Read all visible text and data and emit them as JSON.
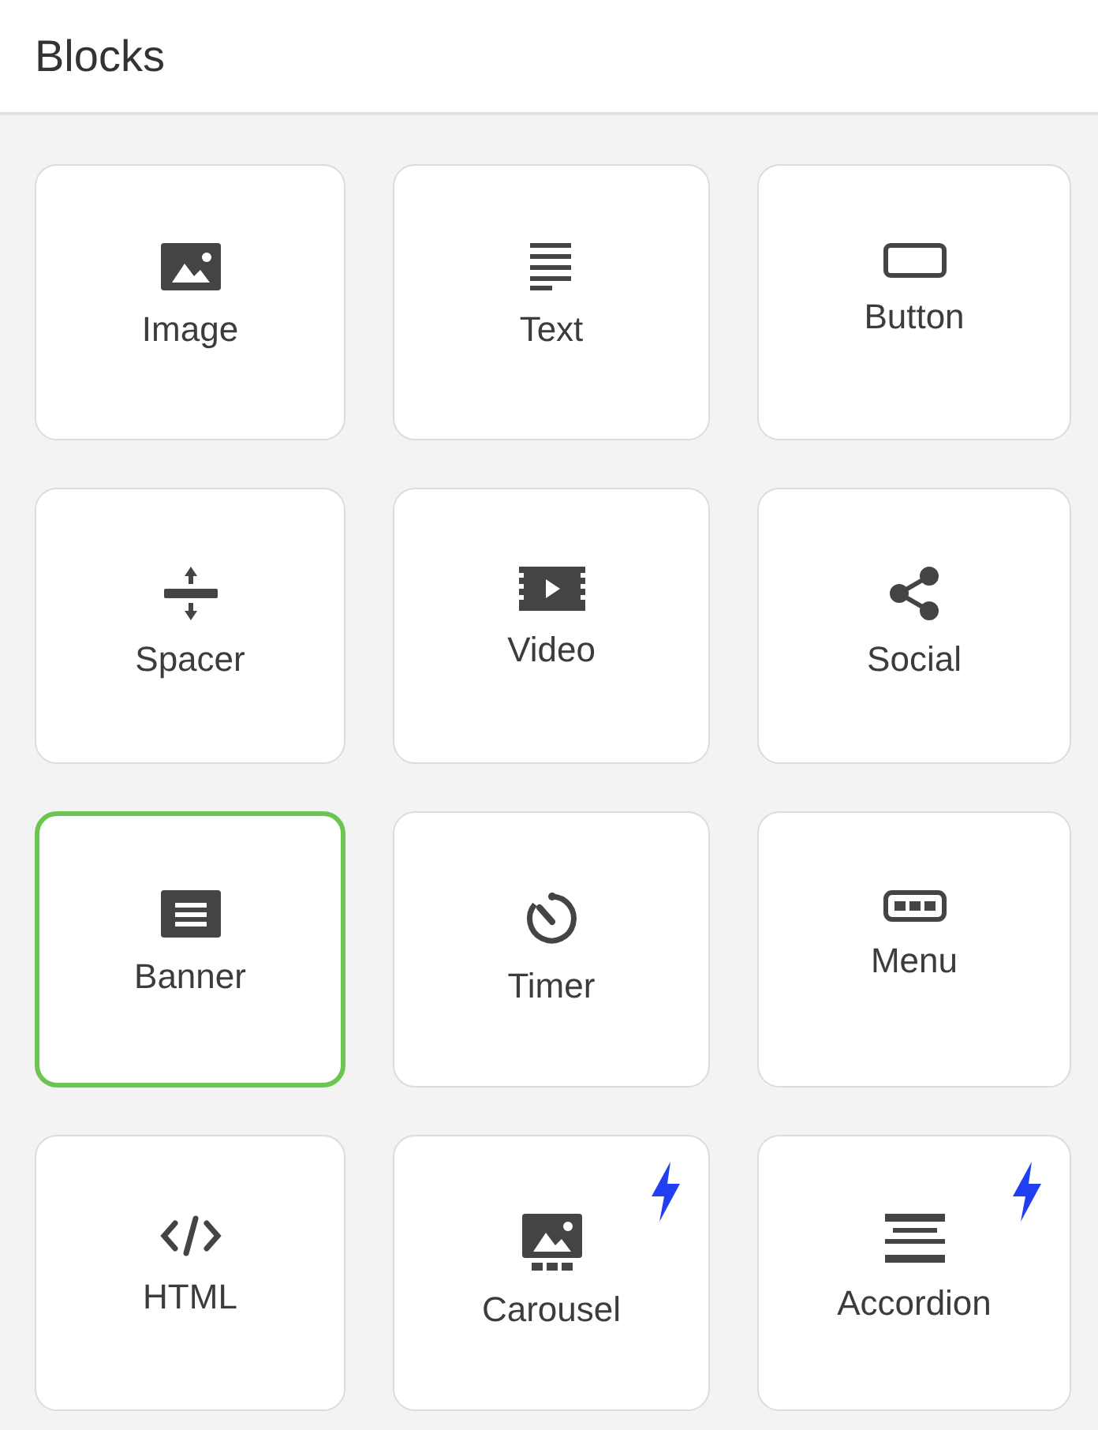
{
  "header": {
    "title": "Blocks"
  },
  "blocks": [
    {
      "label": "Image",
      "selected": false,
      "bolt": false
    },
    {
      "label": "Text",
      "selected": false,
      "bolt": false
    },
    {
      "label": "Button",
      "selected": false,
      "bolt": false
    },
    {
      "label": "Spacer",
      "selected": false,
      "bolt": false
    },
    {
      "label": "Video",
      "selected": false,
      "bolt": false
    },
    {
      "label": "Social",
      "selected": false,
      "bolt": false
    },
    {
      "label": "Banner",
      "selected": true,
      "bolt": false
    },
    {
      "label": "Timer",
      "selected": false,
      "bolt": false
    },
    {
      "label": "Menu",
      "selected": false,
      "bolt": false
    },
    {
      "label": "HTML",
      "selected": false,
      "bolt": false
    },
    {
      "label": "Carousel",
      "selected": false,
      "bolt": true
    },
    {
      "label": "Accordion",
      "selected": false,
      "bolt": true
    }
  ]
}
